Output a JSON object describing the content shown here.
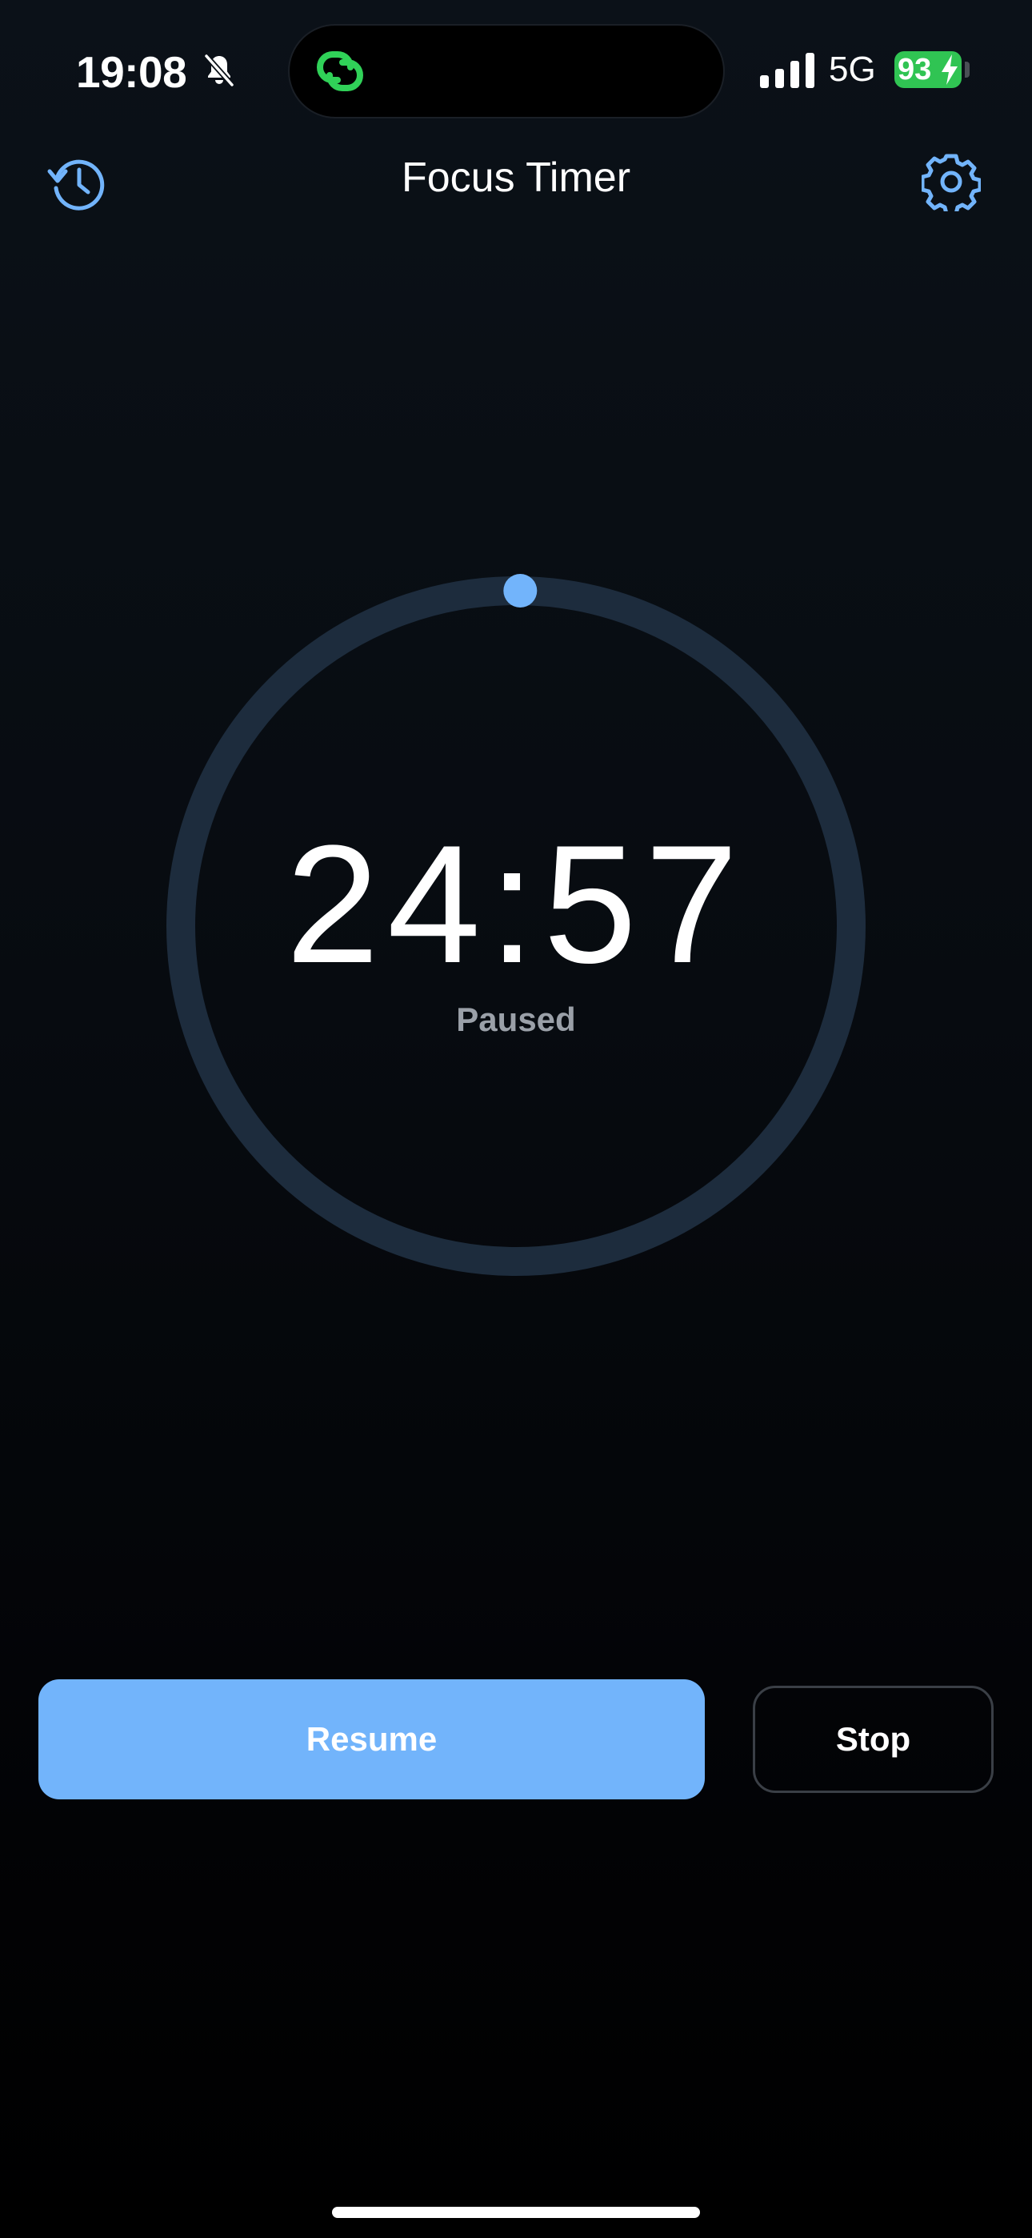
{
  "status_bar": {
    "time": "19:08",
    "network": "5G",
    "battery_level": "93",
    "silent_icon": "bell-slash-icon",
    "signal_icon": "cellular-signal-icon",
    "island_app_icon": "linked-rings-icon",
    "charging_icon": "bolt-icon"
  },
  "nav": {
    "title": "Focus Timer",
    "left_icon": "history-clock-icon",
    "right_icon": "gear-icon"
  },
  "timer": {
    "time": "24:57",
    "state": "Paused",
    "progress_fraction": 0.002
  },
  "actions": {
    "resume_label": "Resume",
    "stop_label": "Stop"
  },
  "colors": {
    "accent": "#72b4fb",
    "ring_track": "#1d2c3d",
    "battery_green": "#30c453",
    "island_green": "#30d158",
    "muted_text": "#9aa0a8"
  }
}
